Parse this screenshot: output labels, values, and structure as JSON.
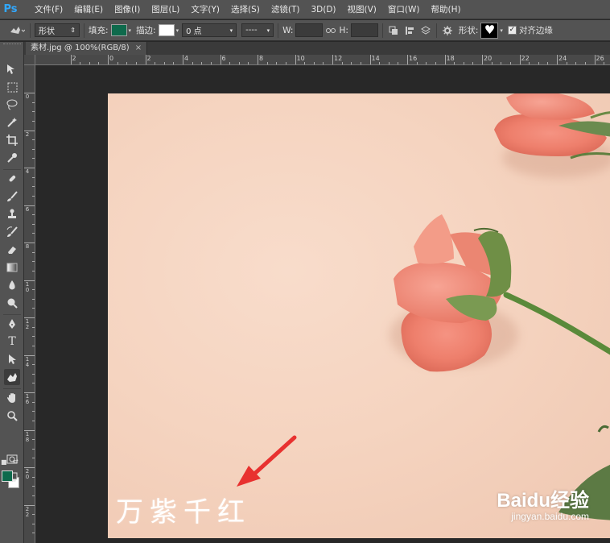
{
  "app": {
    "logo": "Ps"
  },
  "menu": [
    "文件(F)",
    "编辑(E)",
    "图像(I)",
    "图层(L)",
    "文字(Y)",
    "选择(S)",
    "滤镜(T)",
    "3D(D)",
    "视图(V)",
    "窗口(W)",
    "帮助(H)"
  ],
  "options": {
    "mode_value": "形状",
    "fill_label": "填充:",
    "fill_color": "#0e6a4c",
    "stroke_label": "描边:",
    "stroke_color": "#ffffff",
    "stroke_width": "0 点",
    "stroke_style": "----",
    "w_label": "W:",
    "h_label": "H:",
    "shape_label": "形状:",
    "align_edges_label": "对齐边缘",
    "align_edges_checked": true
  },
  "document": {
    "tab_title": "素材.jpg @ 100%(RGB/8)",
    "tab_close": "×"
  },
  "ruler": {
    "h_labels": [
      "0",
      "2",
      "4",
      "6",
      "8",
      "10",
      "12",
      "14",
      "16",
      "18",
      "20",
      "22",
      "24",
      "26"
    ],
    "v_labels": [
      "0",
      "2",
      "4",
      "6",
      "8",
      "10",
      "12",
      "14",
      "16",
      "18",
      "20",
      "22"
    ]
  },
  "colors": {
    "foreground": "#0e6a4c",
    "background": "#ffffff",
    "accent": "#31a8ff"
  },
  "canvas": {
    "caption": "万紫千红",
    "watermark_brand": "Baidu经验",
    "watermark_url": "jingyan.baidu.com"
  }
}
